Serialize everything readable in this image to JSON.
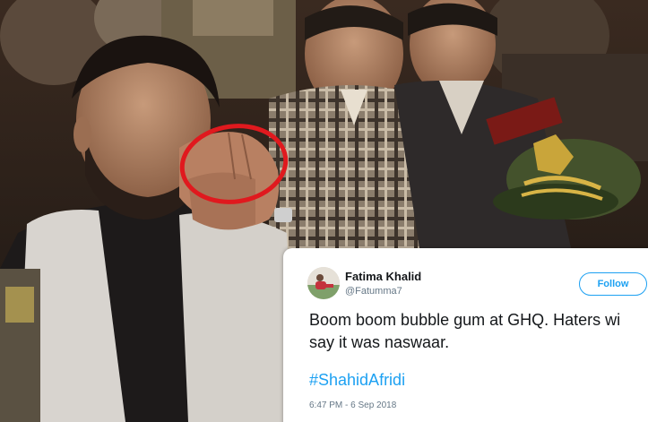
{
  "tweet": {
    "display_name": "Fatima Khalid",
    "handle": "@Fatumma7",
    "follow_label": "Follow",
    "text_line_1": "Boom boom bubble gum at GHQ. Haters wi",
    "text_line_2": "say it was naswaar.",
    "hashtag": "#ShahidAfridi",
    "timestamp": "6:47 PM - 6 Sep 2018"
  },
  "colors": {
    "accent": "#1da1f2",
    "highlight_circle": "#e0191e",
    "card_background": "#ffffff",
    "secondary_text": "#657786"
  },
  "icons": {
    "avatar": "user-avatar-photo"
  }
}
